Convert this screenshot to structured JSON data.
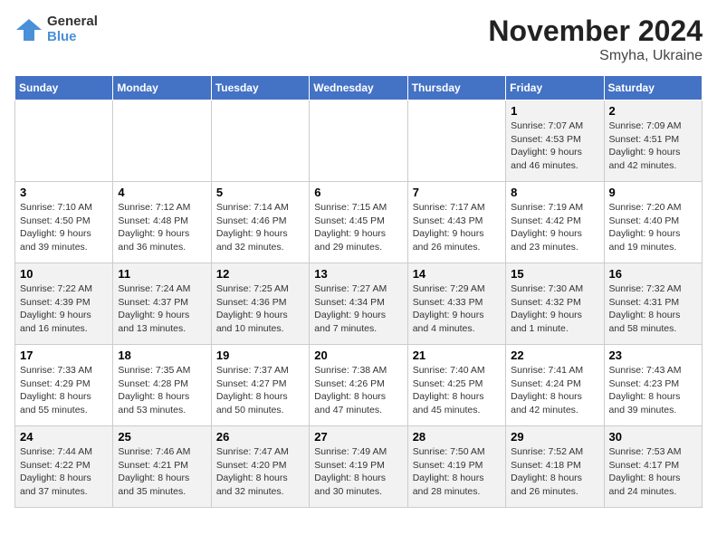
{
  "logo": {
    "general": "General",
    "blue": "Blue"
  },
  "title": "November 2024",
  "subtitle": "Smyha, Ukraine",
  "days_of_week": [
    "Sunday",
    "Monday",
    "Tuesday",
    "Wednesday",
    "Thursday",
    "Friday",
    "Saturday"
  ],
  "weeks": [
    [
      {
        "day": "",
        "info": ""
      },
      {
        "day": "",
        "info": ""
      },
      {
        "day": "",
        "info": ""
      },
      {
        "day": "",
        "info": ""
      },
      {
        "day": "",
        "info": ""
      },
      {
        "day": "1",
        "info": "Sunrise: 7:07 AM\nSunset: 4:53 PM\nDaylight: 9 hours and 46 minutes."
      },
      {
        "day": "2",
        "info": "Sunrise: 7:09 AM\nSunset: 4:51 PM\nDaylight: 9 hours and 42 minutes."
      }
    ],
    [
      {
        "day": "3",
        "info": "Sunrise: 7:10 AM\nSunset: 4:50 PM\nDaylight: 9 hours and 39 minutes."
      },
      {
        "day": "4",
        "info": "Sunrise: 7:12 AM\nSunset: 4:48 PM\nDaylight: 9 hours and 36 minutes."
      },
      {
        "day": "5",
        "info": "Sunrise: 7:14 AM\nSunset: 4:46 PM\nDaylight: 9 hours and 32 minutes."
      },
      {
        "day": "6",
        "info": "Sunrise: 7:15 AM\nSunset: 4:45 PM\nDaylight: 9 hours and 29 minutes."
      },
      {
        "day": "7",
        "info": "Sunrise: 7:17 AM\nSunset: 4:43 PM\nDaylight: 9 hours and 26 minutes."
      },
      {
        "day": "8",
        "info": "Sunrise: 7:19 AM\nSunset: 4:42 PM\nDaylight: 9 hours and 23 minutes."
      },
      {
        "day": "9",
        "info": "Sunrise: 7:20 AM\nSunset: 4:40 PM\nDaylight: 9 hours and 19 minutes."
      }
    ],
    [
      {
        "day": "10",
        "info": "Sunrise: 7:22 AM\nSunset: 4:39 PM\nDaylight: 9 hours and 16 minutes."
      },
      {
        "day": "11",
        "info": "Sunrise: 7:24 AM\nSunset: 4:37 PM\nDaylight: 9 hours and 13 minutes."
      },
      {
        "day": "12",
        "info": "Sunrise: 7:25 AM\nSunset: 4:36 PM\nDaylight: 9 hours and 10 minutes."
      },
      {
        "day": "13",
        "info": "Sunrise: 7:27 AM\nSunset: 4:34 PM\nDaylight: 9 hours and 7 minutes."
      },
      {
        "day": "14",
        "info": "Sunrise: 7:29 AM\nSunset: 4:33 PM\nDaylight: 9 hours and 4 minutes."
      },
      {
        "day": "15",
        "info": "Sunrise: 7:30 AM\nSunset: 4:32 PM\nDaylight: 9 hours and 1 minute."
      },
      {
        "day": "16",
        "info": "Sunrise: 7:32 AM\nSunset: 4:31 PM\nDaylight: 8 hours and 58 minutes."
      }
    ],
    [
      {
        "day": "17",
        "info": "Sunrise: 7:33 AM\nSunset: 4:29 PM\nDaylight: 8 hours and 55 minutes."
      },
      {
        "day": "18",
        "info": "Sunrise: 7:35 AM\nSunset: 4:28 PM\nDaylight: 8 hours and 53 minutes."
      },
      {
        "day": "19",
        "info": "Sunrise: 7:37 AM\nSunset: 4:27 PM\nDaylight: 8 hours and 50 minutes."
      },
      {
        "day": "20",
        "info": "Sunrise: 7:38 AM\nSunset: 4:26 PM\nDaylight: 8 hours and 47 minutes."
      },
      {
        "day": "21",
        "info": "Sunrise: 7:40 AM\nSunset: 4:25 PM\nDaylight: 8 hours and 45 minutes."
      },
      {
        "day": "22",
        "info": "Sunrise: 7:41 AM\nSunset: 4:24 PM\nDaylight: 8 hours and 42 minutes."
      },
      {
        "day": "23",
        "info": "Sunrise: 7:43 AM\nSunset: 4:23 PM\nDaylight: 8 hours and 39 minutes."
      }
    ],
    [
      {
        "day": "24",
        "info": "Sunrise: 7:44 AM\nSunset: 4:22 PM\nDaylight: 8 hours and 37 minutes."
      },
      {
        "day": "25",
        "info": "Sunrise: 7:46 AM\nSunset: 4:21 PM\nDaylight: 8 hours and 35 minutes."
      },
      {
        "day": "26",
        "info": "Sunrise: 7:47 AM\nSunset: 4:20 PM\nDaylight: 8 hours and 32 minutes."
      },
      {
        "day": "27",
        "info": "Sunrise: 7:49 AM\nSunset: 4:19 PM\nDaylight: 8 hours and 30 minutes."
      },
      {
        "day": "28",
        "info": "Sunrise: 7:50 AM\nSunset: 4:19 PM\nDaylight: 8 hours and 28 minutes."
      },
      {
        "day": "29",
        "info": "Sunrise: 7:52 AM\nSunset: 4:18 PM\nDaylight: 8 hours and 26 minutes."
      },
      {
        "day": "30",
        "info": "Sunrise: 7:53 AM\nSunset: 4:17 PM\nDaylight: 8 hours and 24 minutes."
      }
    ]
  ]
}
